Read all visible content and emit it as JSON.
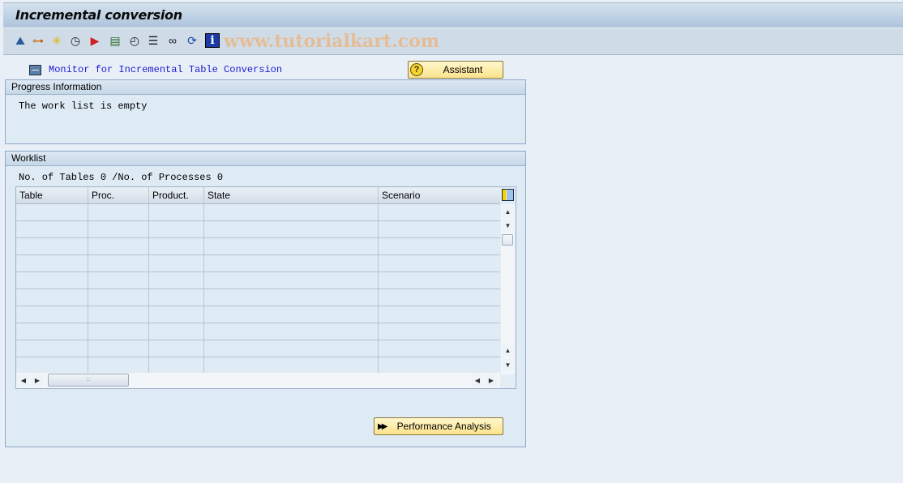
{
  "window": {
    "title": "Incremental conversion"
  },
  "toolbar": {
    "icons": [
      {
        "name": "display-object-icon",
        "glyph": "⛰",
        "color": "#2a5a9a"
      },
      {
        "name": "hierarchy-icon",
        "glyph": "⊶",
        "color": "#c86a10"
      },
      {
        "name": "magic-wand-icon",
        "glyph": "✳",
        "color": "#e0b000"
      },
      {
        "name": "schedule-check-icon",
        "glyph": "◷",
        "color": "#1a1a1a"
      },
      {
        "name": "execute-ab-icon",
        "glyph": "▶",
        "color": "#d02020"
      },
      {
        "name": "log-icon",
        "glyph": "▤",
        "color": "#2a6a2a"
      },
      {
        "name": "clock-icon",
        "glyph": "◴",
        "color": "#1a1a1a"
      },
      {
        "name": "print-stack-icon",
        "glyph": "☰",
        "color": "#1a1a1a"
      },
      {
        "name": "glasses-icon",
        "glyph": "∞",
        "color": "#1a1a1a"
      },
      {
        "name": "refresh-icon",
        "glyph": "⟳",
        "color": "#1a4aa0"
      },
      {
        "name": "info-icon",
        "glyph": "i",
        "color": "#ffffff"
      }
    ],
    "watermark": "www.tutorialkart.com"
  },
  "header": {
    "monitor_link": "Monitor for Incremental Table Conversion",
    "assistant_button": "Assistant"
  },
  "progress": {
    "title": "Progress Information",
    "message": "The work list is empty"
  },
  "worklist": {
    "title": "Worklist",
    "counts": "No. of Tables 0 /No. of Processes 0",
    "columns": [
      "Table",
      "Proc.",
      "Product.",
      "State",
      "Scenario"
    ],
    "rows": [],
    "visible_empty_rows": 10,
    "performance_button": "Performance Analysis"
  },
  "colors": {
    "background": "#e8eff7",
    "button_yellow": "#fbe38c",
    "link_blue": "#1b1bd0"
  }
}
